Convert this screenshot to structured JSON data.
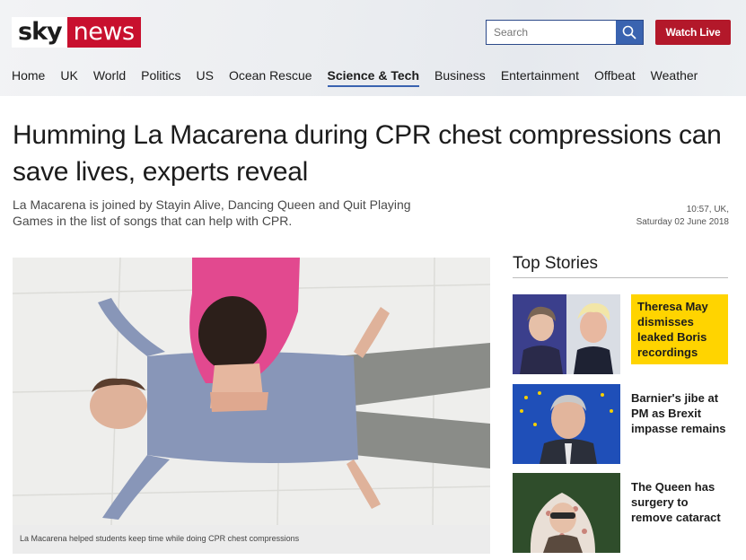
{
  "brand": {
    "logo_sky": "sky",
    "logo_news": "news",
    "accent": "#c8102e"
  },
  "search": {
    "placeholder": "Search",
    "icon": "magnifier-icon"
  },
  "header": {
    "watch_live": "Watch Live"
  },
  "nav": {
    "items": [
      "Home",
      "UK",
      "World",
      "Politics",
      "US",
      "Ocean Rescue",
      "Science & Tech",
      "Business",
      "Entertainment",
      "Offbeat",
      "Weather"
    ],
    "active": "Science & Tech"
  },
  "article": {
    "headline": "Humming La Macarena during CPR chest compressions can save lives, experts reveal",
    "standfirst": "La Macarena is joined by Stayin Alive, Dancing Queen and Quit Playing Games in the list of songs that can help with CPR.",
    "time": "10:57, UK,",
    "date": "Saturday 02 June 2018",
    "image_caption": "La Macarena helped students keep time while doing CPR chest compressions"
  },
  "top_stories": {
    "title": "Top Stories",
    "items": [
      {
        "title": "Theresa May dismisses leaked Boris recordings",
        "highlight": true
      },
      {
        "title": "Barnier's jibe at PM as Brexit impasse remains",
        "highlight": false
      },
      {
        "title": "The Queen has surgery to remove cataract",
        "highlight": false
      }
    ]
  }
}
